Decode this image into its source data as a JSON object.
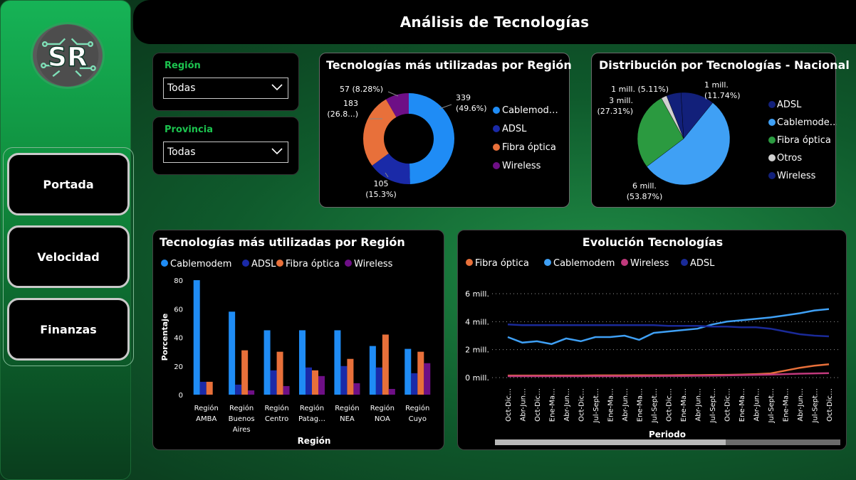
{
  "header": {
    "title": "Análisis de Tecnologías"
  },
  "sidebar": {
    "logo_text": "SR",
    "items": [
      {
        "label": "Portada"
      },
      {
        "label": "Velocidad"
      },
      {
        "label": "Finanzas"
      }
    ]
  },
  "filters": {
    "region": {
      "label": "Región",
      "value": "Todas"
    },
    "provincia": {
      "label": "Provincia",
      "value": "Todas"
    }
  },
  "colors": {
    "cablemodem": "#1f8cf5",
    "adsl": "#1a2aa8",
    "fibra": "#e8703a",
    "wireless": "#6e0f86",
    "otros": "#d0d0d0",
    "pie_cable": "#3fa0f5",
    "pie_fibra": "#2b9a40",
    "pie_adsl": "#12207a"
  },
  "chart_data": [
    {
      "type": "pie",
      "title": "Tecnologías más utilizadas por Región",
      "donut": true,
      "slices": [
        {
          "name": "Cablemod…",
          "value": 339,
          "label_value": "339",
          "label_pct": "(49.6%)"
        },
        {
          "name": "ADSL",
          "value": 105,
          "label_value": "105",
          "label_pct": "(15.3%)"
        },
        {
          "name": "Fibra óptica",
          "value": 183,
          "label_value": "183",
          "label_pct": "(26.8...)"
        },
        {
          "name": "Wireless",
          "value": 57,
          "label_value": "57 (8.28%)",
          "label_pct": ""
        }
      ],
      "legend": [
        "Cablemod…",
        "ADSL",
        "Fibra óptica",
        "Wireless"
      ]
    },
    {
      "type": "pie",
      "title": "Distribución por Tecnologías - Nacional",
      "slices": [
        {
          "name": "ADSL",
          "value": 11.74,
          "label_value": "1 mill.",
          "label_pct": "(11.74%)"
        },
        {
          "name": "Cablemode…",
          "value": 53.87,
          "label_value": "6 mill.",
          "label_pct": "(53.87%)"
        },
        {
          "name": "Fibra óptica",
          "value": 27.31,
          "label_value": "3 mill.",
          "label_pct": "(27.31%)"
        },
        {
          "name": "Otros",
          "value": 1.97,
          "label_value": "",
          "label_pct": ""
        },
        {
          "name": "Wireless",
          "value": 5.11,
          "label_value": "1 mill. (5.11%)",
          "label_pct": ""
        }
      ],
      "legend": [
        "ADSL",
        "Cablemode…",
        "Fibra óptica",
        "Otros",
        "Wireless"
      ]
    },
    {
      "type": "bar",
      "title": "Tecnologías más utilizadas por Región",
      "xlabel": "Región",
      "ylabel": "Porcentaje",
      "ylim": [
        0,
        80
      ],
      "yticks": [
        "0",
        "20",
        "40",
        "60",
        "80"
      ],
      "categories": [
        [
          "Región",
          "AMBA"
        ],
        [
          "Región",
          "Buenos",
          "Aires"
        ],
        [
          "Región",
          "Centro"
        ],
        [
          "Región",
          "Patag…"
        ],
        [
          "Región",
          "NEA"
        ],
        [
          "Región",
          "NOA"
        ],
        [
          "Región",
          "Cuyo"
        ]
      ],
      "series": [
        {
          "name": "Cablemodem",
          "values": [
            80,
            58,
            45,
            45,
            45,
            34,
            32
          ]
        },
        {
          "name": "ADSL",
          "values": [
            9,
            7,
            17,
            19,
            20,
            19,
            15
          ]
        },
        {
          "name": "Fibra óptica",
          "values": [
            9,
            31,
            30,
            17,
            25,
            42,
            30
          ]
        },
        {
          "name": "Wireless",
          "values": [
            0,
            3,
            6,
            13,
            8,
            4,
            22
          ]
        }
      ]
    },
    {
      "type": "line",
      "title": "Evolución Tecnologías",
      "xlabel": "Periodo",
      "ylim": [
        0,
        6
      ],
      "yticks": [
        "0 mill.",
        "2 mill.",
        "4 mill.",
        "6 mill."
      ],
      "x": [
        "Oct-Dic…",
        "Abr-Jun…",
        "Oct-Dic…",
        "Ene-Ma…",
        "Abr-Jun…",
        "Oct-Dic…",
        "Jul-Sept…",
        "Ene-Ma…",
        "Abr-Jun…",
        "Ene-Ma…",
        "Jul-Sept…",
        "Oct-Dic…",
        "Ene-Ma…",
        "Abr-Jun…",
        "Jul-Sept…",
        "Oct-Dic…",
        "Ene-Ma…",
        "Abr-Jun…",
        "Jul-Sept…",
        "Ene-Ma…",
        "Abr-Jun…",
        "Jul-Sept…",
        "Oct-Dic…"
      ],
      "series": [
        {
          "name": "Fibra óptica",
          "values": [
            0.15,
            0.15,
            0.15,
            0.15,
            0.15,
            0.15,
            0.16,
            0.16,
            0.16,
            0.17,
            0.17,
            0.17,
            0.18,
            0.18,
            0.19,
            0.2,
            0.22,
            0.25,
            0.3,
            0.5,
            0.7,
            0.85,
            0.95
          ]
        },
        {
          "name": "Cablemodem",
          "values": [
            2.9,
            2.5,
            2.6,
            2.4,
            2.8,
            2.6,
            2.9,
            2.9,
            3.0,
            2.7,
            3.2,
            3.3,
            3.4,
            3.5,
            3.8,
            4.0,
            4.1,
            4.2,
            4.3,
            4.45,
            4.6,
            4.8,
            4.9
          ]
        },
        {
          "name": "Wireless",
          "values": [
            0.1,
            0.1,
            0.1,
            0.1,
            0.1,
            0.1,
            0.1,
            0.1,
            0.1,
            0.1,
            0.11,
            0.12,
            0.12,
            0.13,
            0.14,
            0.16,
            0.18,
            0.2,
            0.22,
            0.25,
            0.28,
            0.3,
            0.32
          ]
        },
        {
          "name": "ADSL",
          "values": [
            3.8,
            3.75,
            3.75,
            3.75,
            3.75,
            3.75,
            3.75,
            3.75,
            3.75,
            3.75,
            3.75,
            3.7,
            3.7,
            3.7,
            3.65,
            3.65,
            3.6,
            3.6,
            3.5,
            3.3,
            3.1,
            3.0,
            2.95
          ]
        }
      ]
    }
  ]
}
